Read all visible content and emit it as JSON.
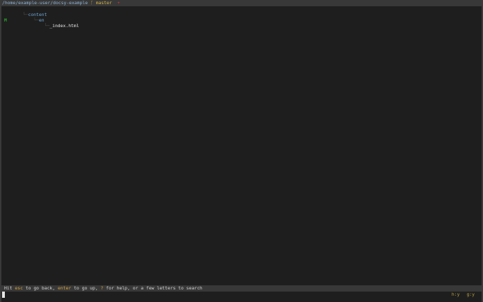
{
  "header": {
    "path": "/home/example-user/docsy-example",
    "branch_symbol": "ᚴ",
    "branch": "master",
    "dirty_mark": "+"
  },
  "tree": {
    "items": [
      {
        "guide": "  └─",
        "label": "content",
        "kind": "dir",
        "mark": ""
      },
      {
        "guide": "      └─",
        "label": "en",
        "kind": "dir",
        "mark": ""
      },
      {
        "guide": "          └─",
        "label": "_index.html",
        "kind": "file",
        "mark": "M"
      }
    ]
  },
  "status": {
    "hit": "Hit ",
    "esc": "esc",
    "t1": " to go back, ",
    "enter": "enter",
    "t2": " to go up, ",
    "q": "?",
    "t3": " for help, or a few letters to search"
  },
  "counts": {
    "h": "h:y",
    "g": "g:y"
  },
  "colors": {
    "background": "#1e1e1e",
    "bar": "#383838",
    "path": "#8fb4d8",
    "branch": "#d7b444",
    "dir": "#6fa6d6",
    "modified": "#2fa02f",
    "key": "#d7a33a"
  }
}
